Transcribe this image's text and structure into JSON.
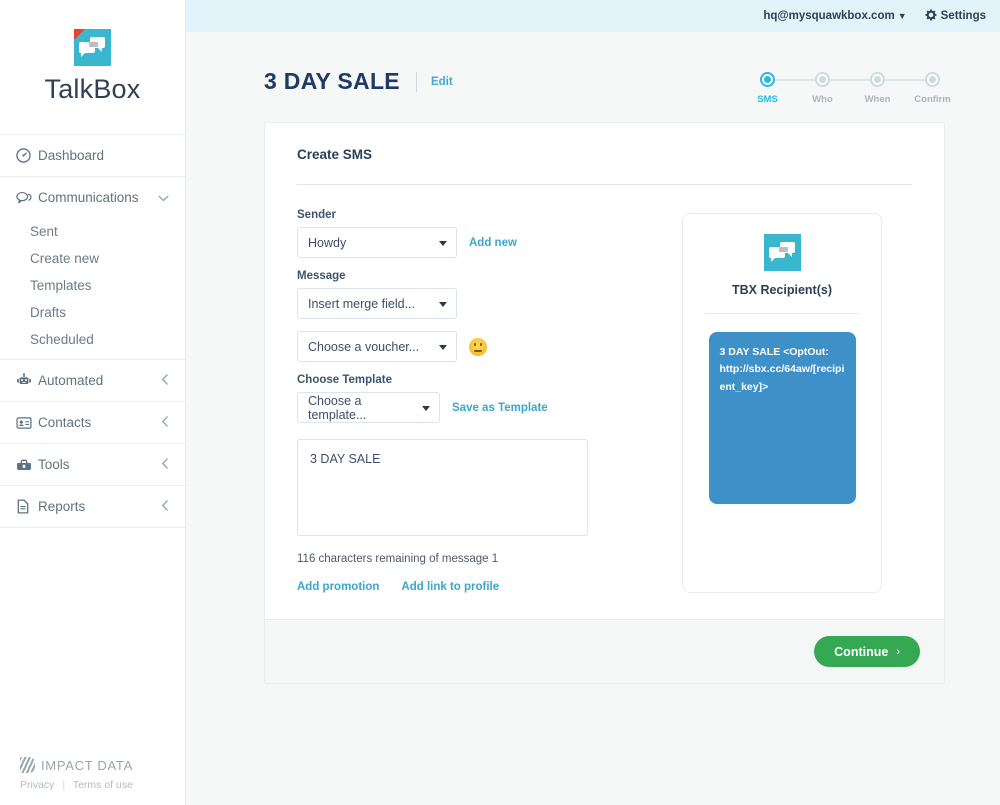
{
  "brand": {
    "name": "TalkBox",
    "logo_icon": "talkbox-chat-icon"
  },
  "topbar": {
    "account": "hq@mysquawkbox.com",
    "caret_icon": "chevron-down-icon",
    "settings_label": "Settings",
    "settings_icon": "gear-icon"
  },
  "sidebar": {
    "items": [
      {
        "label": "Dashboard",
        "icon": "dashboard-icon"
      },
      {
        "label": "Communications",
        "icon": "chat-icon",
        "chevron": "chevron-down-icon"
      },
      {
        "label": "Automated",
        "icon": "robot-icon",
        "chevron": "chevron-left-icon"
      },
      {
        "label": "Contacts",
        "icon": "contact-card-icon",
        "chevron": "chevron-left-icon"
      },
      {
        "label": "Tools",
        "icon": "toolbox-icon",
        "chevron": "chevron-left-icon"
      },
      {
        "label": "Reports",
        "icon": "document-icon",
        "chevron": "chevron-left-icon"
      }
    ],
    "subitems": [
      {
        "label": "Sent"
      },
      {
        "label": "Create new"
      },
      {
        "label": "Templates"
      },
      {
        "label": "Drafts"
      },
      {
        "label": "Scheduled"
      }
    ],
    "footer": {
      "company": "IMPACT DATA",
      "privacy": "Privacy",
      "separator": "|",
      "terms": "Terms of use"
    }
  },
  "page": {
    "title": "3 DAY SALE",
    "edit_label": "Edit"
  },
  "stepper": {
    "steps": [
      {
        "label": "SMS",
        "active": true
      },
      {
        "label": "Who",
        "active": false
      },
      {
        "label": "When",
        "active": false
      },
      {
        "label": "Confirm",
        "active": false
      }
    ]
  },
  "form": {
    "card_title": "Create SMS",
    "sender_label": "Sender",
    "sender_value": "Howdy",
    "add_new_label": "Add new",
    "message_label": "Message",
    "merge_field_value": "Insert merge field...",
    "voucher_value": "Choose a voucher...",
    "emoji_icon": "smiley-icon",
    "choose_template_label": "Choose Template",
    "template_value": "Choose a template...",
    "save_template_label": "Save as Template",
    "message_text": "3 DAY SALE",
    "char_count": "116 characters remaining of message 1",
    "add_promotion_label": "Add promotion",
    "add_link_label": "Add link to profile"
  },
  "preview": {
    "recipient_label": "TBX Recipient(s)",
    "message": "3 DAY SALE <OptOut: http://sbx.cc/64aw/[recipient_key]>"
  },
  "footer": {
    "continue_label": "Continue",
    "continue_arrow": "›"
  },
  "colors": {
    "brand_teal": "#3ab6cf",
    "accent_blue": "#3aa6cb",
    "step_active": "#2bb7e0",
    "bubble_blue": "#3d90c8",
    "continue_green": "#34a853",
    "topbar_bg": "#e2f3fa"
  }
}
